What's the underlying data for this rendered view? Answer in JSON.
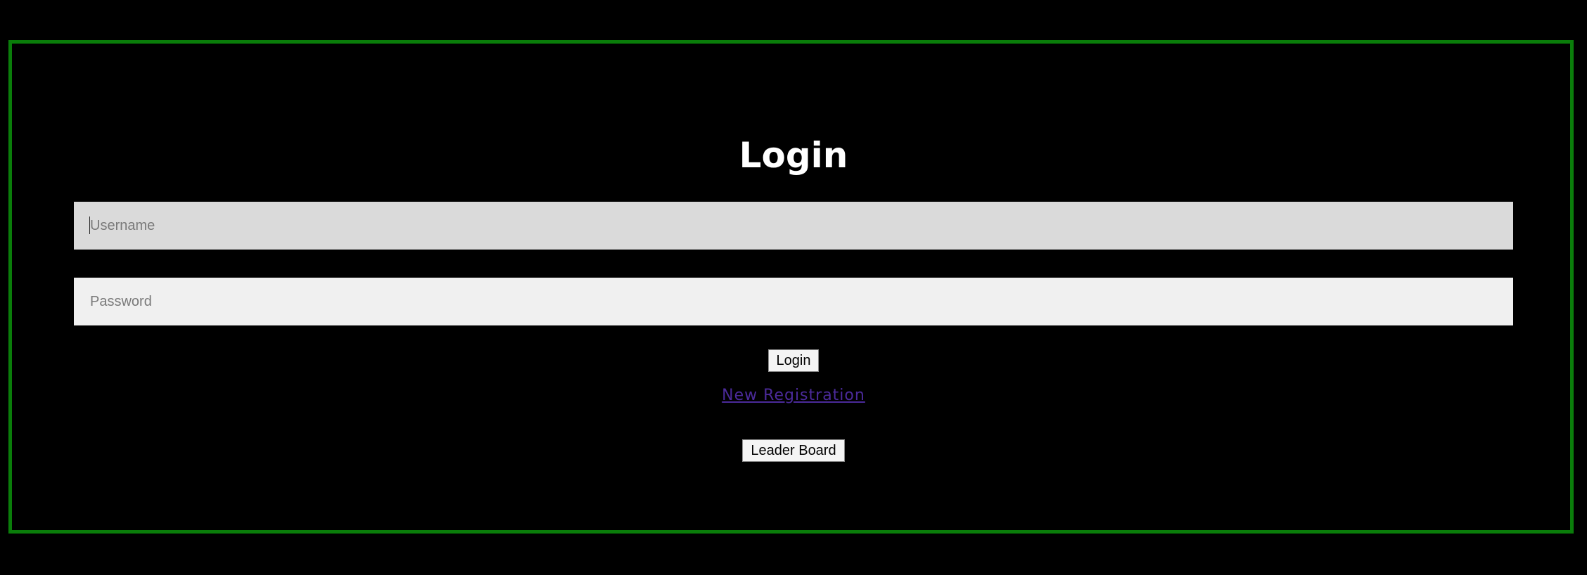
{
  "login_form": {
    "title": "Login",
    "username": {
      "value": "",
      "placeholder": "Username"
    },
    "password": {
      "value": "",
      "placeholder": "Password"
    },
    "login_button_label": "Login",
    "registration_link_label": "New Registration",
    "leaderboard_button_label": "Leader Board"
  },
  "colors": {
    "background": "#000000",
    "frame_border": "#0a7d0a",
    "title_text": "#ffffff",
    "username_field_bg": "#dadada",
    "password_field_bg": "#f0f0f0",
    "link": "#4b2a9a"
  }
}
